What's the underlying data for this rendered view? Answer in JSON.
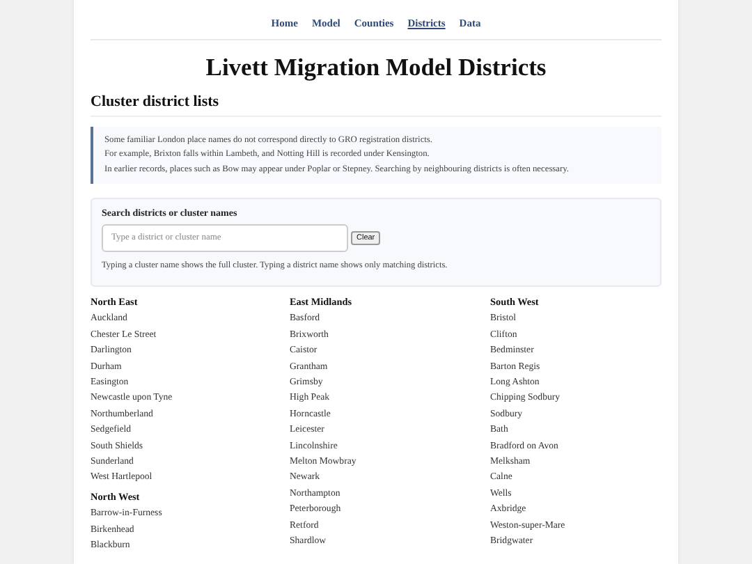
{
  "nav": [
    {
      "label": "Home",
      "selected": false
    },
    {
      "label": "Model",
      "selected": false
    },
    {
      "label": "Counties",
      "selected": false
    },
    {
      "label": "Districts",
      "selected": true
    },
    {
      "label": "Data",
      "selected": false
    }
  ],
  "title": "Livett Migration Model Districts",
  "section_heading": "Cluster district lists",
  "note_lines": [
    "Some familiar London place names do not correspond directly to GRO registration districts.",
    "For example, Brixton falls within Lambeth, and Notting Hill is recorded under Kensington.",
    "In earlier records, places such as Bow may appear under Poplar or Stepney. Searching by neighbouring districts is often necessary."
  ],
  "search": {
    "label": "Search districts or cluster names",
    "placeholder": "Type a district or cluster name",
    "button": "Clear",
    "help": "Typing a cluster name shows the full cluster. Typing a district name shows only matching districts."
  },
  "columns": [
    {
      "groups": [
        {
          "name": "North East",
          "districts": [
            "Auckland",
            "Chester Le Street",
            "Darlington",
            "Durham",
            "Easington",
            "Newcastle upon Tyne",
            "Northumberland",
            "Sedgefield",
            "South Shields",
            "Sunderland",
            "West Hartlepool"
          ]
        },
        {
          "name": "North West",
          "districts": [
            "Barrow-in-Furness",
            "Birkenhead",
            "Blackburn"
          ]
        }
      ]
    },
    {
      "groups": [
        {
          "name": "East Midlands",
          "districts": [
            "Basford",
            "Brixworth",
            "Caistor",
            "Grantham",
            "Grimsby",
            "High Peak",
            "Horncastle",
            "Leicester",
            "Lincolnshire",
            "Melton Mowbray",
            "Newark",
            "Northampton",
            "Peterborough",
            "Retford",
            "Shardlow"
          ]
        }
      ]
    },
    {
      "groups": [
        {
          "name": "South West",
          "districts": [
            "Bristol",
            "Clifton",
            "Bedminster",
            "Barton Regis",
            "Long Ashton",
            "Chipping Sodbury",
            "Sodbury",
            "Bath",
            "Bradford on Avon",
            "Melksham",
            "Calne",
            "Wells",
            "Axbridge",
            "Weston-super-Mare",
            "Bridgwater"
          ]
        }
      ]
    }
  ]
}
